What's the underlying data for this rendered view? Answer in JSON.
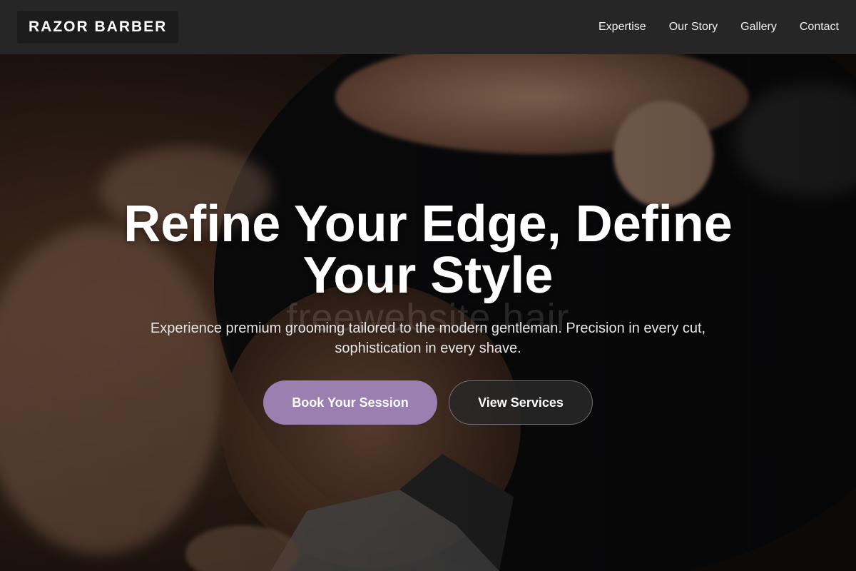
{
  "brand": {
    "name": "RAZOR BARBER"
  },
  "nav": {
    "items": [
      {
        "label": "Expertise"
      },
      {
        "label": "Our Story"
      },
      {
        "label": "Gallery"
      },
      {
        "label": "Contact"
      }
    ]
  },
  "hero": {
    "headline": "Refine Your Edge, Define Your Style",
    "subtext": "Experience premium grooming tailored to the modern gentleman. Precision in every cut, sophistication in every shave.",
    "watermark": "freewebsite.hair",
    "primary_button": "Book Your Session",
    "secondary_button": "View Services"
  },
  "colors": {
    "header_bg": "#262626",
    "primary_accent": "#9b7fb1",
    "text": "#ffffff"
  }
}
